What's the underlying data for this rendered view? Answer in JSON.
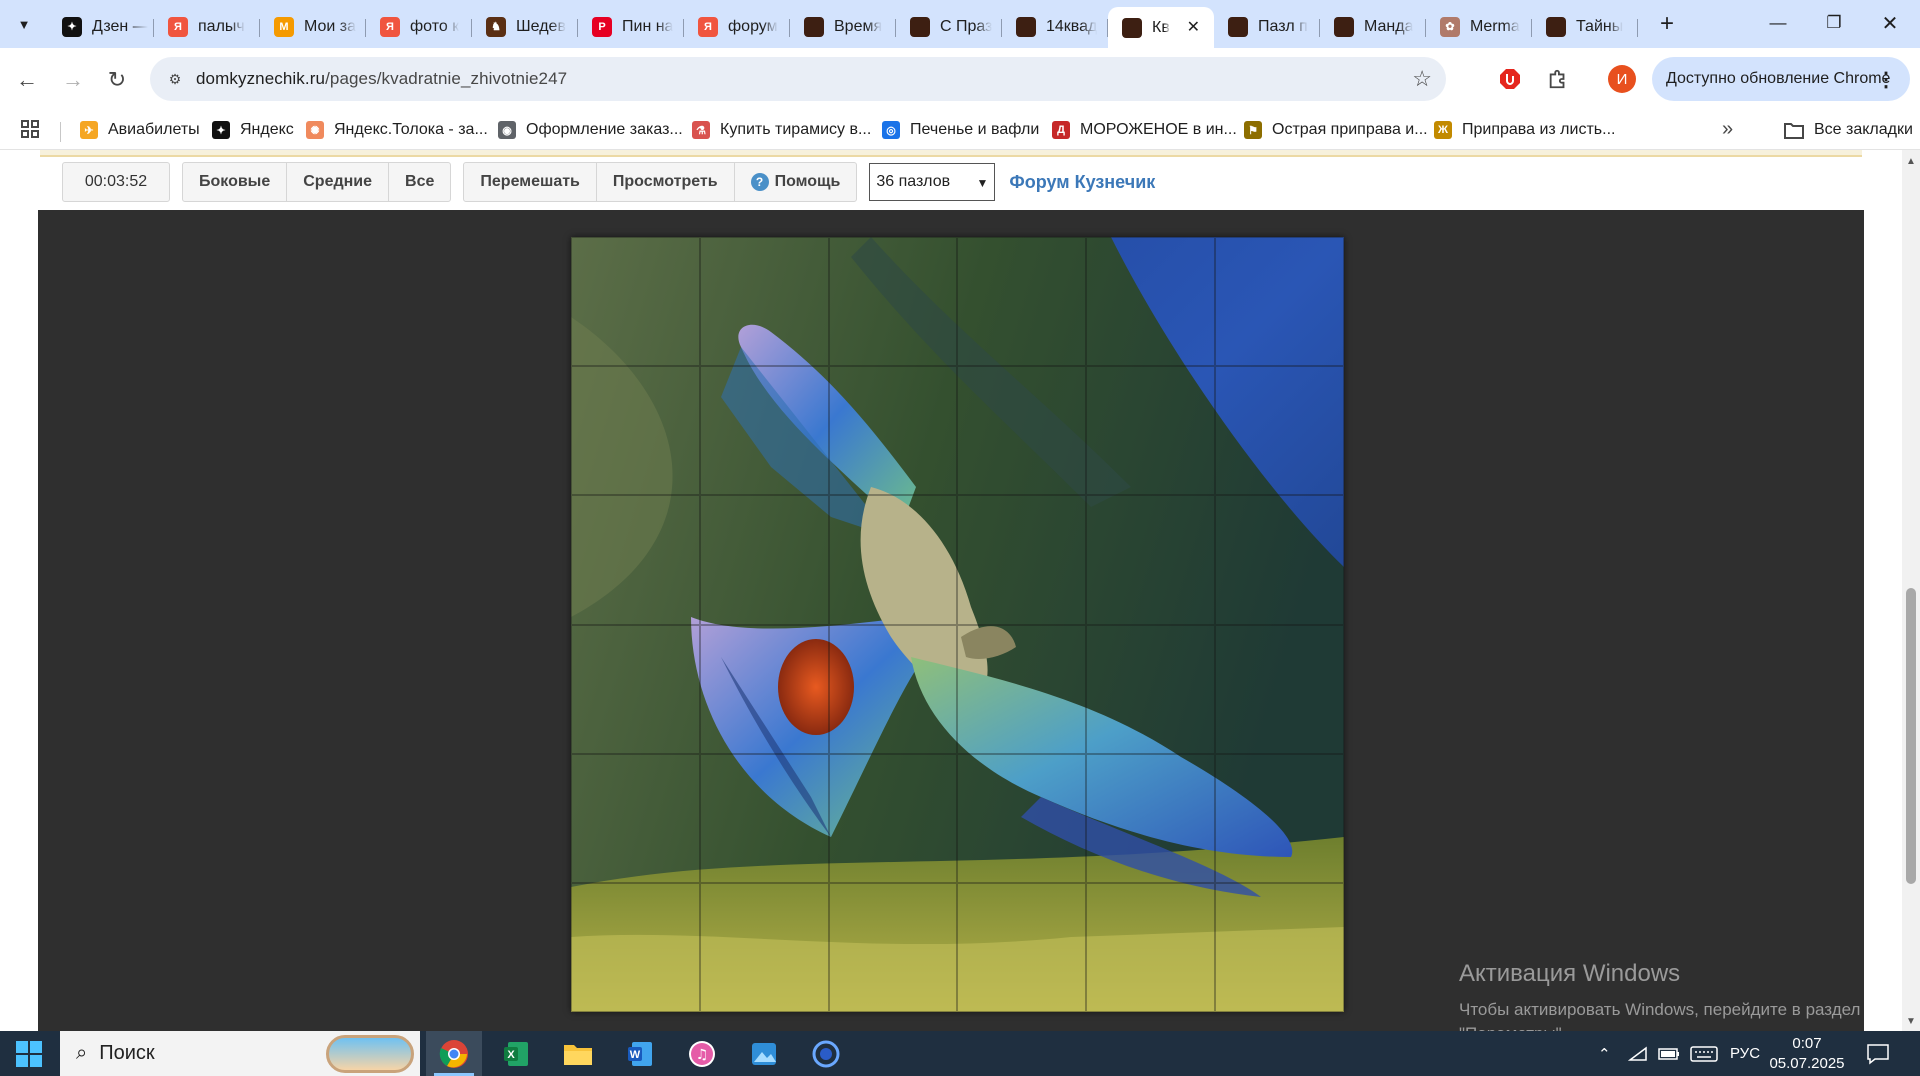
{
  "browser": {
    "tabs": [
      {
        "title": "Дзен —",
        "icon": "dzen-icon",
        "color": "#111111",
        "glyph": "✦"
      },
      {
        "title": "палыч",
        "icon": "yandex-icon",
        "color": "#f0553f",
        "glyph": "Я"
      },
      {
        "title": "Мои за",
        "icon": "maps-icon",
        "color": "#f59a00",
        "glyph": "M"
      },
      {
        "title": "фото к",
        "icon": "yandex-icon",
        "color": "#f0553f",
        "glyph": "Я"
      },
      {
        "title": "Шедев",
        "icon": "art-icon",
        "color": "#5a2f14",
        "glyph": "♞"
      },
      {
        "title": "Пин на",
        "icon": "pinterest-icon",
        "color": "#e60023",
        "glyph": "P"
      },
      {
        "title": "форум",
        "icon": "yandex-icon",
        "color": "#f0553f",
        "glyph": "Я"
      },
      {
        "title": "Время",
        "icon": "kuznechik-icon",
        "color": "#3d1f12",
        "glyph": ""
      },
      {
        "title": "С Праз",
        "icon": "kuznechik-icon",
        "color": "#3d1f12",
        "glyph": ""
      },
      {
        "title": "14квад",
        "icon": "kuznechik-icon",
        "color": "#3d1f12",
        "glyph": ""
      },
      {
        "title": "Кв",
        "icon": "kuznechik-icon",
        "color": "#3d1f12",
        "glyph": "",
        "active": true
      },
      {
        "title": "Пазл п",
        "icon": "kuznechik-icon",
        "color": "#3d1f12",
        "glyph": ""
      },
      {
        "title": "Манда",
        "icon": "kuznechik-icon",
        "color": "#3d1f12",
        "glyph": ""
      },
      {
        "title": "Merma",
        "icon": "mermaid-icon",
        "color": "#b07a6a",
        "glyph": "✿"
      },
      {
        "title": "Тайны",
        "icon": "kuznechik-icon",
        "color": "#3d1f12",
        "glyph": ""
      }
    ],
    "url_domain": "domkyznechik.ru",
    "url_path": "/pages/kvadratnie_zhivotnie247",
    "update_label": "Доступно обновление Chrome",
    "profile_initial": "И"
  },
  "bookmarks": {
    "items": [
      {
        "label": "Авиабилеты",
        "icon": "plane-icon",
        "color": "#f5a623",
        "glyph": "✈"
      },
      {
        "label": "Яндекс",
        "icon": "yandex-icon",
        "color": "#111111",
        "glyph": "✦"
      },
      {
        "label": "Яндекс.Толока - за...",
        "icon": "toloka-icon",
        "color": "#f08a5d",
        "glyph": "✺"
      },
      {
        "label": "Оформление заказ...",
        "icon": "globe-icon",
        "color": "#5f6368",
        "glyph": "◉"
      },
      {
        "label": "Купить тирамису в...",
        "icon": "tiramisu-icon",
        "color": "#d9534f",
        "glyph": "⚗"
      },
      {
        "label": "Печенье и вафли",
        "icon": "cookie-icon",
        "color": "#1a73e8",
        "glyph": "◎"
      },
      {
        "label": "МОРОЖЕНОЕ в ин...",
        "icon": "icecream-icon",
        "color": "#c62828",
        "glyph": "Д"
      },
      {
        "label": "Острая приправа и...",
        "icon": "spice-icon",
        "color": "#8d6e00",
        "glyph": "⚑"
      },
      {
        "label": "Приправа из листь...",
        "icon": "leaf-icon",
        "color": "#c28a00",
        "glyph": "Ж"
      }
    ],
    "all_label": "Все закладки"
  },
  "puzzle": {
    "timer": "00:03:52",
    "view_buttons": [
      "Боковые",
      "Средние",
      "Все"
    ],
    "shuffle_label": "Перемешать",
    "preview_label": "Просмотреть",
    "help_label": "Помощь",
    "count_selected": "36 пазлов",
    "forum_label": "Форум Кузнечик",
    "rows": 6,
    "cols": 6,
    "image_subject": "kea parrot flying over mountain valley",
    "colors": {
      "sky": "#2a56b5",
      "slope": "#3c5a3a",
      "grass": "#9aa63a",
      "wing_blue": "#3a78d0",
      "wing_green": "#6fbf8a",
      "orange": "#d8481a",
      "body": "#b7b28a"
    }
  },
  "windows_activation": {
    "title": "Активация Windows",
    "line1": "Чтобы активировать Windows, перейдите в раздел",
    "line2": "\"Параметры\"."
  },
  "taskbar": {
    "search_placeholder": "Поиск",
    "apps": [
      "chrome-icon",
      "excel-icon",
      "file-explorer-icon",
      "word-icon",
      "itunes-icon",
      "photos-icon",
      "app-icon"
    ],
    "language": "РУС",
    "time": "0:07",
    "date": "05.07.2025"
  }
}
